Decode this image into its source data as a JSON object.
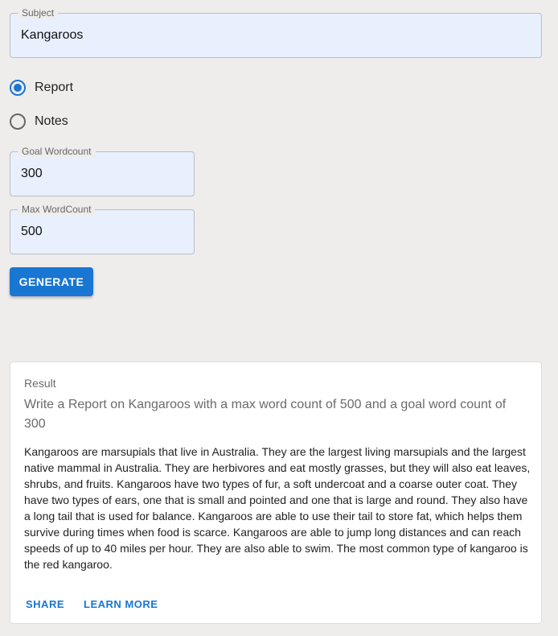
{
  "form": {
    "subject": {
      "legend": "Subject",
      "value": "Kangaroos"
    },
    "type_options": [
      {
        "label": "Report",
        "checked": true
      },
      {
        "label": "Notes",
        "checked": false
      }
    ],
    "goal_wordcount": {
      "legend": "Goal Wordcount",
      "value": "300"
    },
    "max_wordcount": {
      "legend": "Max WordCount",
      "value": "500"
    },
    "generate_label": "GENERATE"
  },
  "result": {
    "overline": "Result",
    "heading": "Write a Report on Kangaroos with a max word count of 500 and a goal word count of 300",
    "body": "Kangaroos are marsupials that live in Australia. They are the largest living marsupials and the largest native mammal in Australia. They are herbivores and eat mostly grasses, but they will also eat leaves, shrubs, and fruits. Kangaroos have two types of fur, a soft undercoat and a coarse outer coat. They have two types of ears, one that is small and pointed and one that is large and round. They also have a long tail that is used for balance. Kangaroos are able to use their tail to store fat, which helps them survive during times when food is scarce. Kangaroos are able to jump long distances and can reach speeds of up to 40 miles per hour. They are also able to swim. The most common type of kangaroo is the red kangaroo.",
    "actions": [
      "SHARE",
      "LEARN MORE"
    ]
  },
  "colors": {
    "accent": "#1976d2",
    "background": "#efecec",
    "field_fill": "#e8f0fe"
  }
}
